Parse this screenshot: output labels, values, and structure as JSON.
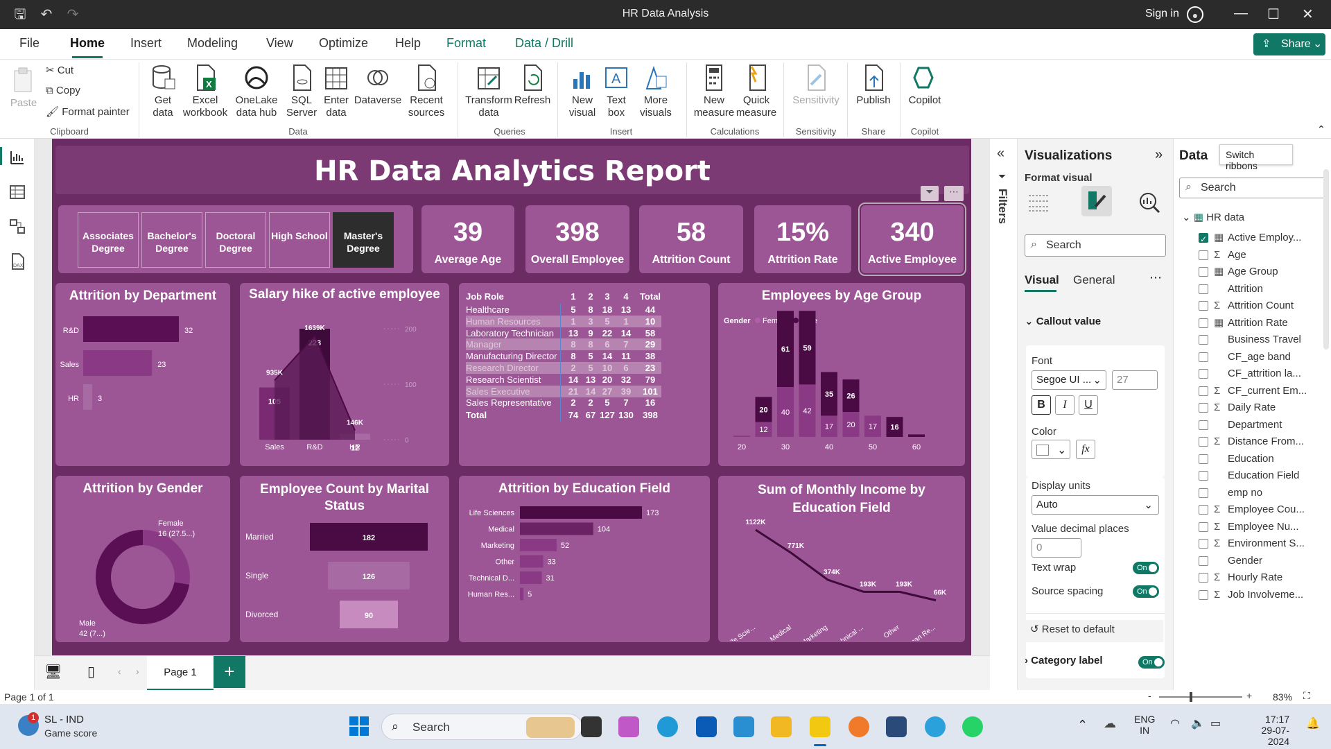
{
  "window": {
    "title": "HR Data Analysis",
    "signin": "Sign in"
  },
  "menu": {
    "items": [
      "File",
      "Home",
      "Insert",
      "Modeling",
      "View",
      "Optimize",
      "Help",
      "Format",
      "Data / Drill"
    ],
    "share": "Share"
  },
  "ribbon": {
    "clipboard": {
      "paste": "Paste",
      "cut": "Cut",
      "copy": "Copy",
      "format_painter": "Format painter",
      "group": "Clipboard"
    },
    "data": {
      "get_data": "Get data",
      "excel": "Excel workbook",
      "onelake": "OneLake data hub",
      "sql": "SQL Server",
      "enter": "Enter data",
      "dataverse": "Dataverse",
      "recent": "Recent sources",
      "group": "Data"
    },
    "queries": {
      "transform": "Transform data",
      "refresh": "Refresh",
      "group": "Queries"
    },
    "insert": {
      "new_visual": "New visual",
      "text_box": "Text box",
      "more_visuals": "More visuals",
      "group": "Insert"
    },
    "calculations": {
      "new_measure": "New measure",
      "quick_measure": "Quick measure",
      "group": "Calculations"
    },
    "sensitivity": {
      "label": "Sensitivity",
      "group": "Sensitivity"
    },
    "share": {
      "publish": "Publish",
      "group": "Share"
    },
    "copilot": {
      "label": "Copilot",
      "group": "Copilot"
    }
  },
  "report": {
    "title": "HR Data Analytics Report",
    "slicer": [
      "Associates Degree",
      "Bachelor's Degree",
      "Doctoral Degree",
      "High School",
      "Master's Degree"
    ],
    "slicer_selected": 4,
    "kpis": [
      {
        "value": "39",
        "label": "Average Age"
      },
      {
        "value": "398",
        "label": "Overall Employee"
      },
      {
        "value": "58",
        "label": "Attrition Count"
      },
      {
        "value": "15%",
        "label": "Attrition Rate"
      },
      {
        "value": "340",
        "label": "Active Employee"
      }
    ],
    "titles": {
      "dept": "Attrition by Department",
      "salary": "Salary hike of active employee",
      "age": "Employees by Age Group",
      "gender": "Attrition by Gender",
      "marital": "Employee Count by Marital Status",
      "education": "Attrition by Education Field",
      "income": "Sum of Monthly Income by Education Field"
    },
    "matrix": {
      "headers": [
        "Job Role",
        "1",
        "2",
        "3",
        "4",
        "Total"
      ],
      "rows": [
        [
          "Healthcare Representative",
          "5",
          "8",
          "18",
          "13",
          "44"
        ],
        [
          "Human Resources",
          "1",
          "3",
          "5",
          "1",
          "10"
        ],
        [
          "Laboratory Technician",
          "13",
          "9",
          "22",
          "14",
          "58"
        ],
        [
          "Manager",
          "8",
          "8",
          "6",
          "7",
          "29"
        ],
        [
          "Manufacturing Director",
          "8",
          "5",
          "14",
          "11",
          "38"
        ],
        [
          "Research Director",
          "2",
          "5",
          "10",
          "6",
          "23"
        ],
        [
          "Research Scientist",
          "14",
          "13",
          "20",
          "32",
          "79"
        ],
        [
          "Sales Executive",
          "21",
          "14",
          "27",
          "39",
          "101"
        ],
        [
          "Sales Representative",
          "2",
          "2",
          "5",
          "7",
          "16"
        ]
      ],
      "total": [
        "Total",
        "74",
        "67",
        "127",
        "130",
        "398"
      ]
    }
  },
  "chart_data": [
    {
      "type": "bar",
      "title": "Attrition by Department",
      "categories": [
        "R&D",
        "Sales",
        "HR"
      ],
      "values": [
        32,
        23,
        3
      ]
    },
    {
      "type": "bar",
      "title": "Salary hike of active employee",
      "categories": [
        "Sales",
        "R&D",
        "HR"
      ],
      "series": [
        {
          "values": [
            105,
            223,
            12
          ]
        },
        {
          "values": [
            935,
            1639,
            146
          ],
          "labels": [
            "935K",
            "1639K",
            "146K"
          ]
        }
      ],
      "y_ticks": [
        "200",
        "100",
        "0"
      ]
    },
    {
      "type": "bar",
      "title": "Employees by Age Group",
      "legend_title": "Gender",
      "categories": [
        "20",
        "25",
        "30",
        "35",
        "40",
        "45",
        "50",
        "55",
        "60"
      ],
      "x_ticks": [
        "20",
        "30",
        "40",
        "50",
        "60"
      ],
      "series": [
        {
          "name": "Female",
          "values": [
            1,
            12,
            40,
            42,
            17,
            20,
            17,
            0,
            0
          ]
        },
        {
          "name": "Male",
          "values": [
            0,
            20,
            61,
            59,
            35,
            26,
            0,
            16,
            2
          ]
        }
      ]
    },
    {
      "type": "pie",
      "title": "Attrition by Gender",
      "labels": [
        "Female",
        "Male"
      ],
      "values": [
        16,
        42
      ],
      "data_labels": [
        "16 (27.5...)",
        "42 (7...)"
      ]
    },
    {
      "type": "bar",
      "title": "Employee Count by Marital Status",
      "categories": [
        "Married",
        "Single",
        "Divorced"
      ],
      "values": [
        182,
        126,
        90
      ]
    },
    {
      "type": "bar",
      "title": "Attrition by Education Field",
      "categories": [
        "Life Sciences",
        "Medical",
        "Marketing",
        "Other",
        "Technical D...",
        "Human Res..."
      ],
      "values": [
        173,
        104,
        52,
        33,
        31,
        5
      ]
    },
    {
      "type": "line",
      "title": "Sum of Monthly Income by Education Field",
      "categories": [
        "Life Scie...",
        "Medical",
        "Marketing",
        "Technical ...",
        "Other",
        "Human Re..."
      ],
      "values": [
        1122,
        771,
        374,
        193,
        193,
        66
      ],
      "labels": [
        "1122K",
        "771K",
        "374K",
        "193K",
        "193K",
        "66K"
      ]
    }
  ],
  "visualizations": {
    "title": "Visualizations",
    "format_visual": "Format visual",
    "search": "Search",
    "tabs": [
      "Visual",
      "General"
    ],
    "section": "Callout value",
    "font_label": "Font",
    "font_value": "Segoe UI ...",
    "font_size": "27",
    "color_label": "Color",
    "display_units_label": "Display units",
    "display_units": "Auto",
    "decimals_label": "Value decimal places",
    "decimals": "0",
    "text_wrap": "Text wrap",
    "source_spacing": "Source spacing",
    "on": "On",
    "reset": "Reset to default",
    "category_label": "Category label"
  },
  "data_pane": {
    "title": "Data",
    "tooltip": "Switch ribbons",
    "search": "Search",
    "table": "HR data",
    "fields": [
      {
        "name": "Active Employ...",
        "sigma": false,
        "calc": true,
        "checked": true
      },
      {
        "name": "Age",
        "sigma": true,
        "checked": false
      },
      {
        "name": "Age Group",
        "calc": true,
        "checked": false
      },
      {
        "name": "Attrition",
        "checked": false
      },
      {
        "name": "Attrition Count",
        "sigma": true,
        "checked": false
      },
      {
        "name": "Attrition Rate",
        "calc": true,
        "checked": false
      },
      {
        "name": "Business Travel",
        "checked": false
      },
      {
        "name": "CF_age band",
        "checked": false
      },
      {
        "name": "CF_attrition la...",
        "checked": false
      },
      {
        "name": "CF_current Em...",
        "sigma": true,
        "checked": false
      },
      {
        "name": "Daily Rate",
        "sigma": true,
        "checked": false
      },
      {
        "name": "Department",
        "checked": false
      },
      {
        "name": "Distance From...",
        "sigma": true,
        "checked": false
      },
      {
        "name": "Education",
        "checked": false
      },
      {
        "name": "Education Field",
        "checked": false
      },
      {
        "name": "emp no",
        "checked": false
      },
      {
        "name": "Employee Cou...",
        "sigma": true,
        "checked": false
      },
      {
        "name": "Employee Nu...",
        "sigma": true,
        "checked": false
      },
      {
        "name": "Environment S...",
        "sigma": true,
        "checked": false
      },
      {
        "name": "Gender",
        "checked": false
      },
      {
        "name": "Hourly Rate",
        "sigma": true,
        "checked": false
      },
      {
        "name": "Job Involveme...",
        "sigma": true,
        "checked": false
      }
    ]
  },
  "filters_label": "Filters",
  "pages": {
    "page1": "Page 1"
  },
  "status": {
    "page_of": "Page 1 of 1",
    "zoom": "83%"
  },
  "taskbar": {
    "weather_badge": "1",
    "weather_line1": "SL - IND",
    "weather_line2": "Game score",
    "search": "Search",
    "lang1": "ENG",
    "lang2": "IN",
    "time": "17:17",
    "date": "29-07-2024"
  },
  "colors": {
    "accent": "#117865",
    "report_bg": "#6b2c63",
    "card": "#9c5595",
    "dark_purple": "#4a0a44",
    "mid_purple": "#7a2a72"
  }
}
